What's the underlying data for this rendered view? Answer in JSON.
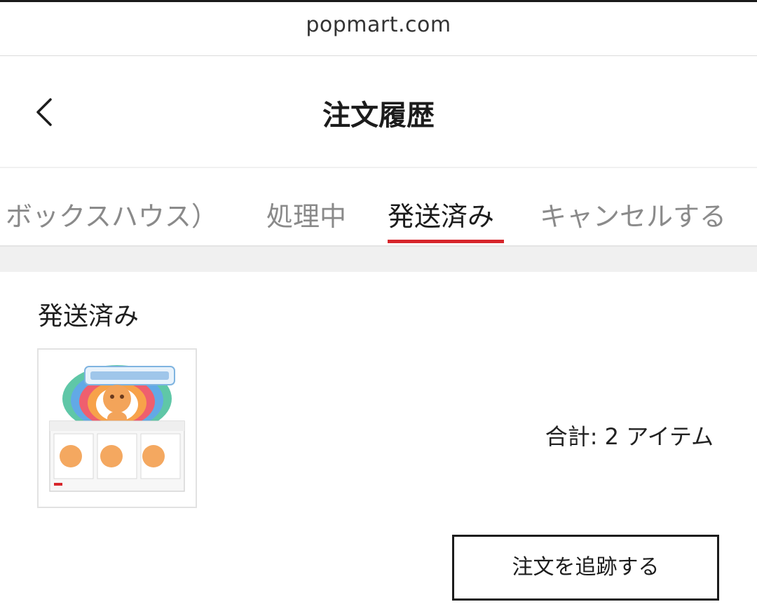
{
  "browser": {
    "url": "popmart.com"
  },
  "header": {
    "title": "注文履歴",
    "back_icon": "chevron-left-icon"
  },
  "tabs": [
    {
      "label": "ボックスハウス）",
      "active": false
    },
    {
      "label": "処理中",
      "active": false
    },
    {
      "label": "発送済み",
      "active": true
    },
    {
      "label": "キャンセルする",
      "active": false
    }
  ],
  "colors": {
    "accent": "#d7262c",
    "tab_inactive": "#8a8a8a",
    "text": "#1c1c1c",
    "band": "#f0f0f0"
  },
  "order": {
    "status": "発送済み",
    "product_image": "blind-box-display-image",
    "total": "合計: 2 アイテム",
    "track_button": "注文を追跡する"
  }
}
